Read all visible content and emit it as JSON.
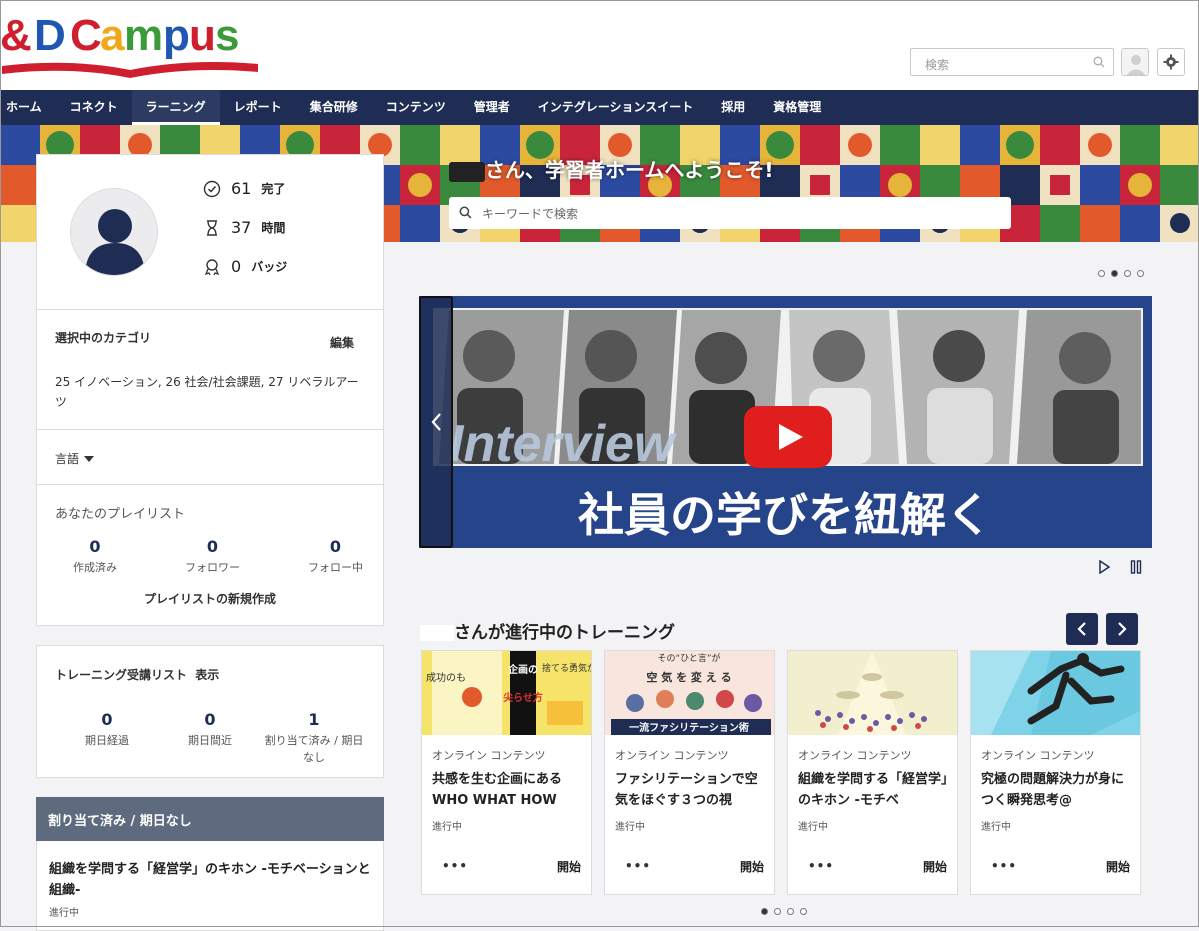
{
  "brand": {
    "logo_text": "&D Campus"
  },
  "header": {
    "search_placeholder": "検索"
  },
  "nav": [
    "ホーム",
    "コネクト",
    "ラーニング",
    "レポート",
    "集合研修",
    "コンテンツ",
    "管理者",
    "インテグレーションスイート",
    "採用",
    "資格管理"
  ],
  "nav_active": "ラーニング",
  "welcome": {
    "text": "さん、学習者ホームへようこそ!",
    "search_placeholder": "キーワードで検索"
  },
  "profile": {
    "completed": {
      "value": "61",
      "unit": "完了"
    },
    "hours": {
      "value": "37",
      "unit": "時間"
    },
    "badges": {
      "value": "0",
      "unit": "バッジ"
    }
  },
  "categories": {
    "label": "選択中のカテゴリ",
    "edit": "編集",
    "list": "25 イノベーション, 26 社会/社会課題, 27 リベラルアーツ"
  },
  "language": {
    "label": "言語"
  },
  "playlist": {
    "title": "あなたのプレイリスト",
    "stats": [
      {
        "num": "0",
        "label": "作成済み"
      },
      {
        "num": "0",
        "label": "フォロワー"
      },
      {
        "num": "0",
        "label": "フォロー中"
      }
    ],
    "create": "プレイリストの新規作成"
  },
  "training_list": {
    "title": "トレーニング受講リスト",
    "show": "表示",
    "stats": [
      {
        "num": "0",
        "label": "期日経過"
      },
      {
        "num": "0",
        "label": "期日間近"
      },
      {
        "num": "1",
        "label": "割り当て済み / 期日なし"
      }
    ]
  },
  "assigned": {
    "header": "割り当て済み / 期日なし",
    "item_title": "組織を学問する「経営学」のキホン -モチベーションと組織-",
    "item_status": "進行中"
  },
  "carousel": {
    "interview": "Interview",
    "caption": "社員の学びを紐解く",
    "dots": 4,
    "active_dot": 1
  },
  "trainings": {
    "title": "さんが進行中のトレーニング",
    "cards": [
      {
        "type": "オンライン コンテンツ",
        "title": "共感を生む企画にある WHO WHAT HOW",
        "status": "進行中",
        "action": "開始",
        "more": "•••"
      },
      {
        "type": "オンライン コンテンツ",
        "title": "ファシリテーションで空気をほぐす３つの視",
        "status": "進行中",
        "action": "開始",
        "more": "•••"
      },
      {
        "type": "オンライン コンテンツ",
        "title": "組織を学問する「経営学」のキホン -モチベ",
        "status": "進行中",
        "action": "開始",
        "more": "•••"
      },
      {
        "type": "オンライン コンテンツ",
        "title": "究極の問題解決力が身につく瞬発思考@",
        "status": "進行中",
        "action": "開始",
        "more": "•••"
      }
    ],
    "thumb_texts": {
      "t1": [
        "企画の",
        "尖らせ方",
        "成功のも",
        "捨てる勇気が"
      ],
      "t2": [
        "その“ひと言”が",
        "空 気 を 変 え る",
        "一流ファシリテーション術"
      ]
    },
    "dots": 4,
    "active_dot": 0
  },
  "colors": {
    "nav_bg": "#1f2d54",
    "accent_red": "#cf1f2e",
    "carousel_blue": "#25448a"
  }
}
